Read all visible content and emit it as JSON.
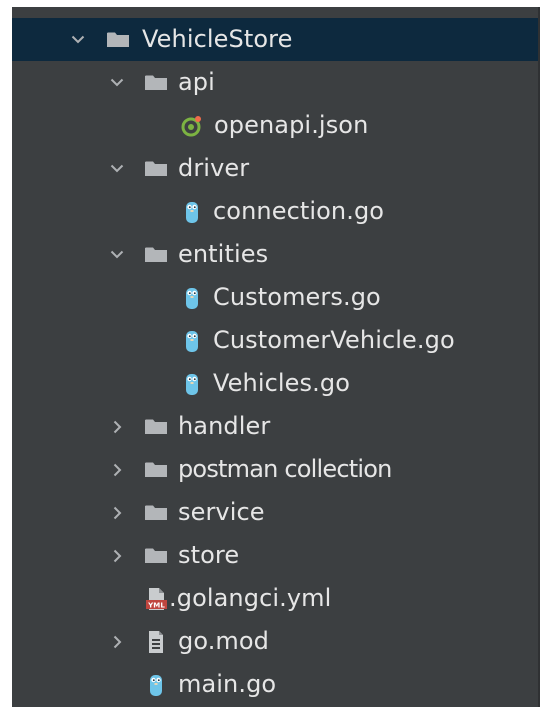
{
  "project_tree": {
    "rows": [
      {
        "label": "VehicleStore",
        "kind": "folder",
        "expanded": true,
        "selected": true,
        "icon": "folder-icon"
      },
      {
        "label": "api",
        "kind": "folder",
        "expanded": true,
        "icon": "folder-icon"
      },
      {
        "label": "openapi.json",
        "kind": "file",
        "icon": "openapi-json-icon"
      },
      {
        "label": "driver",
        "kind": "folder",
        "expanded": true,
        "icon": "folder-icon"
      },
      {
        "label": "connection.go",
        "kind": "file",
        "icon": "go-file-icon"
      },
      {
        "label": "entities",
        "kind": "folder",
        "expanded": true,
        "icon": "folder-icon"
      },
      {
        "label": "Customers.go",
        "kind": "file",
        "icon": "go-file-icon"
      },
      {
        "label": "CustomerVehicle.go",
        "kind": "file",
        "icon": "go-file-icon"
      },
      {
        "label": "Vehicles.go",
        "kind": "file",
        "icon": "go-file-icon"
      },
      {
        "label": "handler",
        "kind": "folder",
        "expanded": false,
        "icon": "folder-icon"
      },
      {
        "label": "postman collection",
        "kind": "folder",
        "expanded": false,
        "icon": "folder-icon"
      },
      {
        "label": "service",
        "kind": "folder",
        "expanded": false,
        "icon": "folder-icon"
      },
      {
        "label": "store",
        "kind": "folder",
        "expanded": false,
        "icon": "folder-icon"
      },
      {
        "label": ".golangci.yml",
        "kind": "file",
        "icon": "yml-file-icon"
      },
      {
        "label": "go.mod",
        "kind": "file",
        "collapsible": true,
        "expanded": false,
        "icon": "go-mod-file-icon"
      },
      {
        "label": "main.go",
        "kind": "file",
        "icon": "go-file-icon"
      }
    ]
  },
  "colors": {
    "panel_background": "#3c3f41",
    "selection": "#0d293e",
    "text": "#e6e6e6",
    "folder": "#b3b6b9",
    "gopher": "#6ec5e9",
    "yml_badge": "#c0463f"
  }
}
